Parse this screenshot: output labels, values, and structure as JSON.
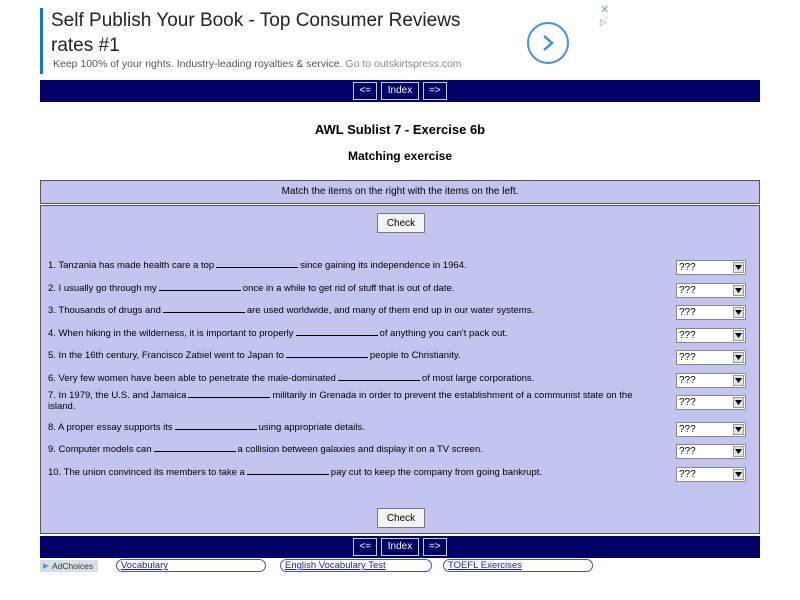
{
  "ad": {
    "title": "Self Publish Your Book - Top Consumer Reviews rates #1",
    "text": "Keep 100% of your rights. Industry-leading royalties & service.",
    "link_text": "Go to outskirtspress.com",
    "close_glyph": "✕",
    "info_glyph": "▷",
    "accent_color": "#1a73c8"
  },
  "nav": {
    "prev": "<=",
    "index": "Index",
    "next": "=>",
    "bar_color": "#000066"
  },
  "page": {
    "title": "AWL Sublist 7 - Exercise 6b",
    "subtitle": "Matching exercise",
    "instructions": "Match the items on the right with the items on the left.",
    "check_label": "Check",
    "panel_color": "#c4c4f0"
  },
  "questions": [
    {
      "before": "1. Tanzania has made health care a top",
      "after": "since gaining its independence in 1964.",
      "answer": "???"
    },
    {
      "before": "2. I usually go through my",
      "after": "once in a while to get rid of stuff that is out of date.",
      "answer": "???"
    },
    {
      "before": "3. Thousands of drugs and",
      "after": "are used worldwide, and many of them end up in our water systems.",
      "answer": "???"
    },
    {
      "before": "4. When hiking in the wilderness, it is important to properly",
      "after": "of anything you can't pack out.",
      "answer": "???"
    },
    {
      "before": "5. In the 16th century, Francisco Zabiel went to Japan to",
      "after": "people to Christianity.",
      "answer": "???"
    },
    {
      "before": "6. Very few women have been able to penetrate the male-dominated",
      "after": "of most large corporations.",
      "answer": "???"
    },
    {
      "before": "7. In 1979, the U.S. and Jamaica",
      "after": "militarily in Grenada in order to prevent the establishment of a communist state on the island.",
      "answer": "???"
    },
    {
      "before": "8. A proper essay supports its",
      "after": "using appropriate details.",
      "answer": "???"
    },
    {
      "before": "9. Computer models can",
      "after": "a collision between galaxies and display it on a TV screen.",
      "answer": "???"
    },
    {
      "before": "10. The union convinced its members to take a",
      "after": "pay cut to keep the company from going bankrupt.",
      "answer": "???"
    }
  ],
  "footer": {
    "adchoices": "AdChoices",
    "links": [
      "Vocabulary",
      "English Vocabulary Test",
      "TOEFL Exercises"
    ]
  }
}
